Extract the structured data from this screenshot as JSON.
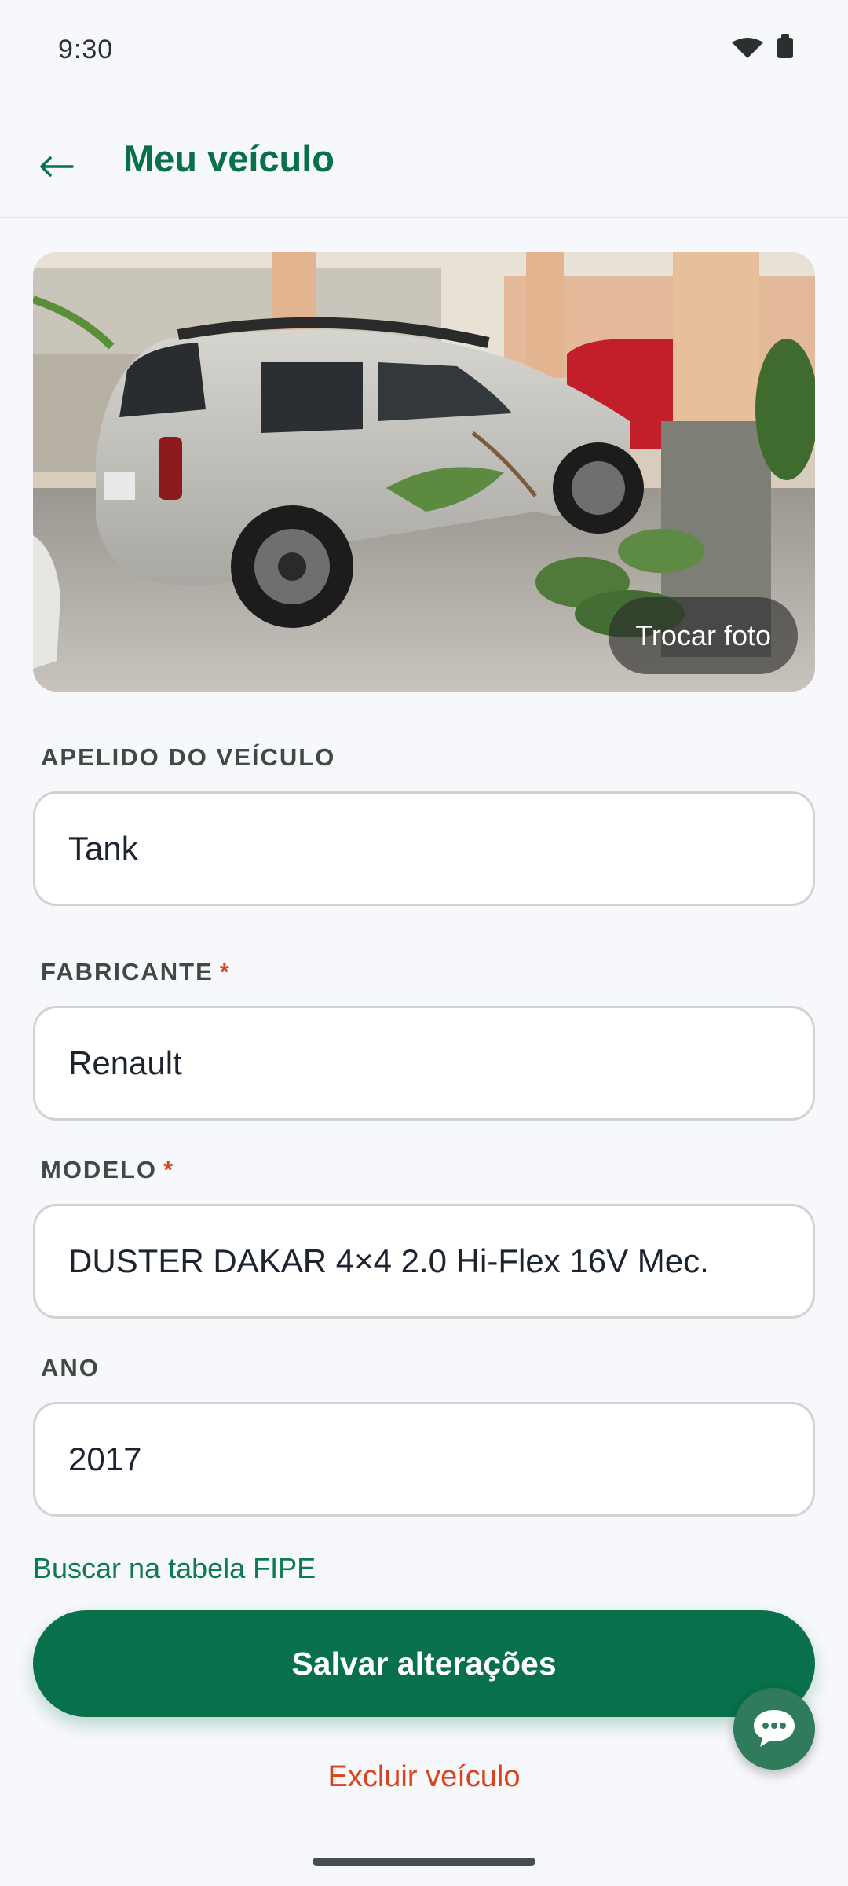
{
  "status_bar": {
    "time": "9:30"
  },
  "header": {
    "title": "Meu veículo"
  },
  "photo": {
    "change_label": "Trocar foto"
  },
  "fields": {
    "nickname": {
      "label": "APELIDO DO VEÍCULO",
      "value": "Tank"
    },
    "manufacturer": {
      "label": "FABRICANTE",
      "required_mark": "*",
      "value": "Renault"
    },
    "model": {
      "label": "MODELO",
      "required_mark": "*",
      "value": "DUSTER DAKAR 4×4 2.0 Hi-Flex 16V Mec."
    },
    "year": {
      "label": "ANO",
      "value": "2017"
    }
  },
  "actions": {
    "fipe_link": "Buscar na tabela FIPE",
    "save_label": "Salvar alterações",
    "delete_label": "Excluir veículo"
  },
  "colors": {
    "primary": "#08704a",
    "danger": "#d9421b",
    "background": "#f7f8fc"
  },
  "icons": {
    "back": "arrow-left-icon",
    "chat": "chat-bubble-icon",
    "wifi": "wifi-icon",
    "battery": "battery-icon"
  }
}
